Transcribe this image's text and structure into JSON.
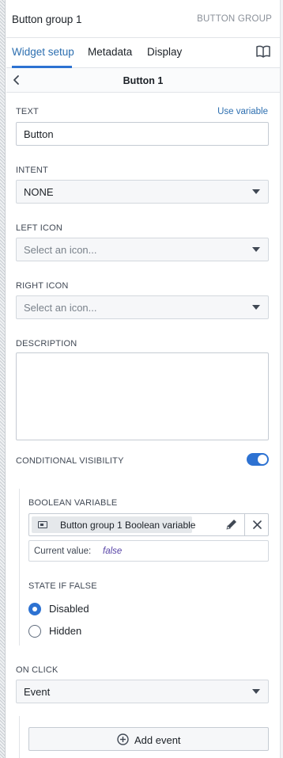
{
  "header": {
    "title": "Button group 1",
    "type_label": "BUTTON GROUP"
  },
  "tabs": [
    {
      "label": "Widget setup",
      "active": true
    },
    {
      "label": "Metadata",
      "active": false
    },
    {
      "label": "Display",
      "active": false
    }
  ],
  "icons": {
    "docs": "book-icon",
    "back": "chevron-left-icon",
    "edit": "pencil-icon",
    "remove": "close-icon",
    "add": "plus-circle-icon",
    "variable": "boolean-variable-icon"
  },
  "subheader": {
    "title": "Button 1"
  },
  "text_field": {
    "label": "TEXT",
    "link": "Use variable",
    "value": "Button"
  },
  "intent": {
    "label": "INTENT",
    "value": "NONE"
  },
  "left_icon": {
    "label": "LEFT ICON",
    "placeholder": "Select an icon..."
  },
  "right_icon": {
    "label": "RIGHT ICON",
    "placeholder": "Select an icon..."
  },
  "description": {
    "label": "DESCRIPTION",
    "value": ""
  },
  "conditional_visibility": {
    "label": "CONDITIONAL VISIBILITY",
    "enabled": true
  },
  "boolean_variable": {
    "label": "BOOLEAN VARIABLE",
    "name": "Button group 1 Boolean variable",
    "current_value_label": "Current value:",
    "current_value": "false"
  },
  "state_if_false": {
    "label": "STATE IF FALSE",
    "options": [
      {
        "label": "Disabled",
        "selected": true
      },
      {
        "label": "Hidden",
        "selected": false
      }
    ]
  },
  "on_click": {
    "label": "ON CLICK",
    "value": "Event",
    "add_label": "Add event"
  },
  "colors": {
    "accent": "#2d72d2",
    "link": "#2d6fb0",
    "value_italic": "#5642a6"
  }
}
